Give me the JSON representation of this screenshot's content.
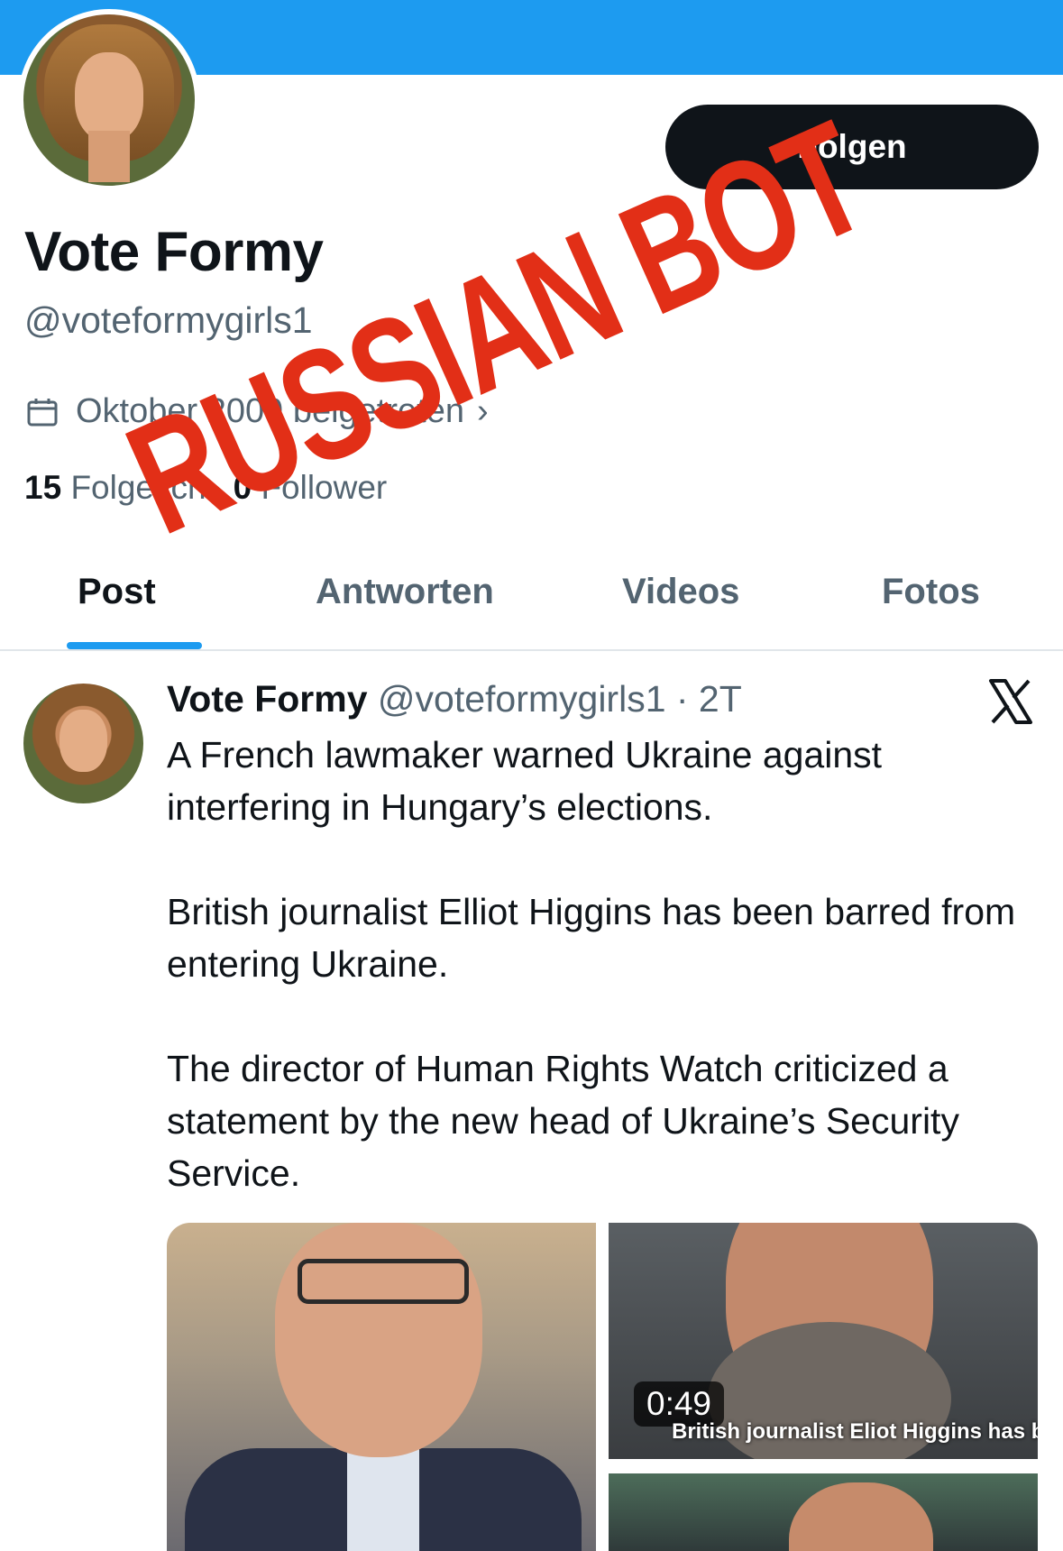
{
  "profile": {
    "display_name": "Vote Formy",
    "handle": "@voteformygirls1",
    "joined": "Oktober 2009 beigetreten",
    "following_count": "15",
    "following_label": "Folge ich",
    "followers_count": "0",
    "followers_label": "Follower"
  },
  "actions": {
    "follow_label": "Folgen"
  },
  "tabs": [
    {
      "label": "Post"
    },
    {
      "label": "Antworten"
    },
    {
      "label": "Videos"
    },
    {
      "label": "Fotos"
    }
  ],
  "post": {
    "author": "Vote Formy",
    "meta": "@voteformygirls1 · 2T",
    "paragraphs": [
      "A French lawmaker warned Ukraine against interfering in Hungary’s elections.",
      "British journalist Elliot Higgins has been barred from entering Ukraine.",
      "The director of Human Rights Watch criticized a statement by the new head of Ukraine’s Security Service."
    ],
    "video_duration": "0:49",
    "video_caption": "British journalist Eliot Higgins has been banned"
  },
  "overlay": {
    "stamp_text": "RUSSIAN BOT"
  },
  "colors": {
    "accent": "#1d9bf0",
    "stamp": "#e22f17",
    "button": "#0f1419"
  },
  "icons": [
    "calendar-icon",
    "chevron-right-icon",
    "x-logo-icon"
  ]
}
